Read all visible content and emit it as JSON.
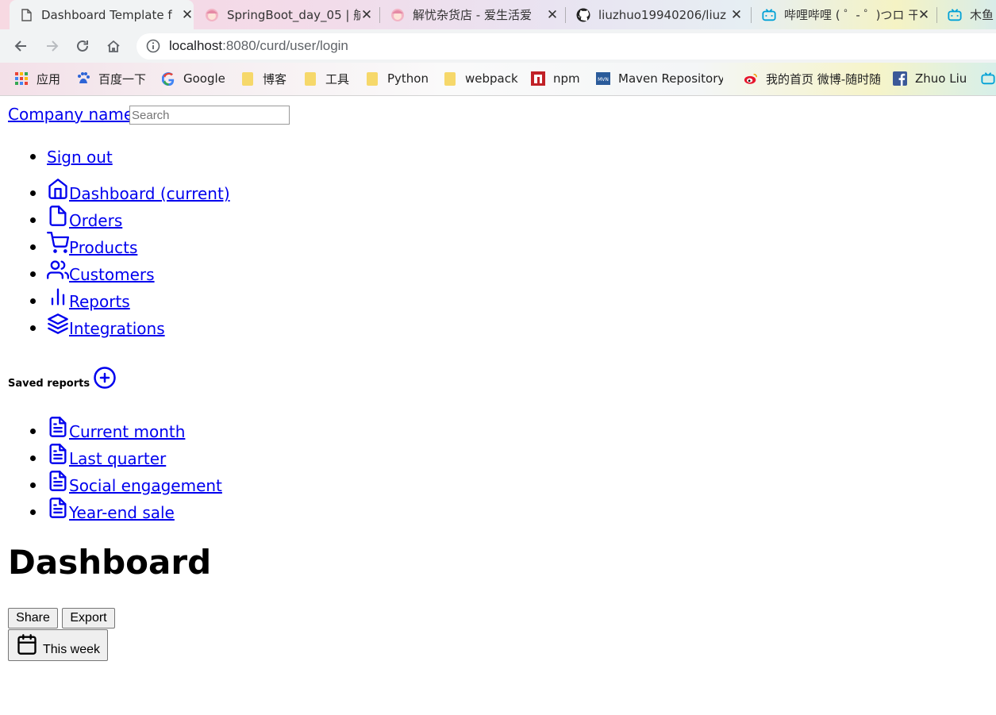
{
  "browser": {
    "tabs": [
      {
        "title": "Dashboard Template f",
        "icon": "page-icon",
        "active": true
      },
      {
        "title": "SpringBoot_day_05 | 航",
        "icon": "anime-avatar-icon",
        "active": false
      },
      {
        "title": "解忧杂货店 - 爱生活爱",
        "icon": "anime-avatar-icon",
        "active": false
      },
      {
        "title": "liuzhuo19940206/liuz",
        "icon": "github-icon",
        "active": false
      },
      {
        "title": "哔哩哔哩 ( ゜- ゜)つロ 干",
        "icon": "bilibili-icon",
        "active": false
      },
      {
        "title": "木鱼",
        "icon": "bilibili-icon",
        "active": false
      }
    ],
    "url_host": "localhost",
    "url_rest": ":8080/curd/user/login",
    "bookmarks": [
      {
        "label": "应用",
        "icon": "apps-grid-icon"
      },
      {
        "label": "百度一下",
        "icon": "baidu-icon"
      },
      {
        "label": "Google",
        "icon": "google-icon"
      },
      {
        "label": "博客",
        "icon": "folder-icon"
      },
      {
        "label": "工具",
        "icon": "folder-icon"
      },
      {
        "label": "Python",
        "icon": "folder-icon"
      },
      {
        "label": "webpack",
        "icon": "folder-icon"
      },
      {
        "label": "npm",
        "icon": "npm-icon"
      },
      {
        "label": "Maven Repository: ",
        "icon": "maven-icon"
      },
      {
        "label": "我的首页 微博-随时随",
        "icon": "weibo-icon"
      },
      {
        "label": "Zhuo Liu",
        "icon": "facebook-icon"
      }
    ]
  },
  "header": {
    "brand": "Company name",
    "search_placeholder": "Search",
    "signout": "Sign out"
  },
  "sidebar": {
    "nav": [
      {
        "label": " Dashboard (current)",
        "icon": "home-icon"
      },
      {
        "label": " Orders",
        "icon": "file-icon"
      },
      {
        "label": " Products",
        "icon": "shopping-cart-icon"
      },
      {
        "label": " Customers",
        "icon": "users-icon"
      },
      {
        "label": " Reports",
        "icon": "bar-chart-icon"
      },
      {
        "label": " Integrations",
        "icon": "layers-icon"
      }
    ],
    "saved_heading": "Saved reports",
    "reports": [
      {
        "label": " Current month",
        "icon": "file-text-icon"
      },
      {
        "label": " Last quarter",
        "icon": "file-text-icon"
      },
      {
        "label": " Social engagement",
        "icon": "file-text-icon"
      },
      {
        "label": " Year-end sale",
        "icon": "file-text-icon"
      }
    ]
  },
  "main": {
    "title": "Dashboard",
    "share_label": "Share",
    "export_label": "Export",
    "period_label": "This week"
  },
  "colors": {
    "link": "#0000ee",
    "chrome_toolbar": "#f1f3f4"
  }
}
